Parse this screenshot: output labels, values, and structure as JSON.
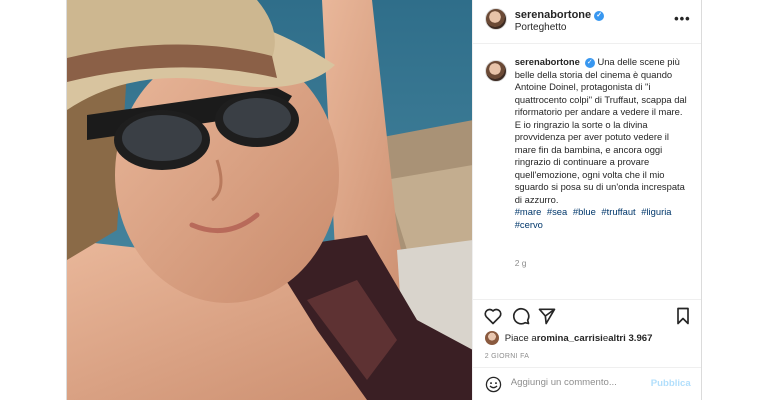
{
  "post": {
    "username": "serenabortone",
    "location": "Porteghetto",
    "more_label": "•••",
    "caption": {
      "username": "serenabortone",
      "text": "Una delle scene più belle della storia del cinema è quando Antoine Doinel, protagonista di \"i quattrocento colpi\" di Truffaut, scappa dal riformatorio per andare a vedere il mare. E io ringrazio la sorte o la divina provvidenza per aver potuto vedere il mare fin da bambina, e ancora oggi ringrazio di continuare a provare quell'emozione, ogni volta che il mio sguardo si posa su di un'onda increspata di azzurro.",
      "hashtags": [
        "#mare",
        "#sea",
        "#blue",
        "#truffaut",
        "#liguria",
        "#cervo"
      ]
    },
    "timestamp": "2 g",
    "likes": {
      "prefix": "Piace a ",
      "user": "romina_carrisi",
      "middle": " e ",
      "others": "altri 3.967"
    },
    "posted_ago": "2 GIORNI FA",
    "comment": {
      "placeholder": "Aggiungi un commento...",
      "publish_label": "Pubblica"
    }
  },
  "icons": [
    "heart-icon",
    "comment-icon",
    "share-icon",
    "bookmark-icon",
    "emoji-icon",
    "verified-icon",
    "more-icon"
  ],
  "colors": {
    "link": "#00376b",
    "verified": "#3897f0",
    "publish_disabled": "#b2dffc",
    "muted": "#8e8e8e"
  }
}
